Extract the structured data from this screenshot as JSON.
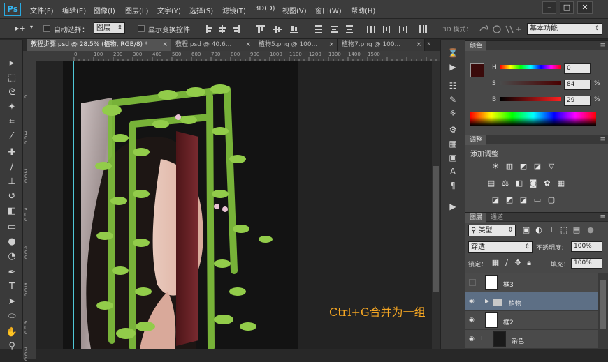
{
  "menubar": {
    "logo": "Ps",
    "items": [
      "文件(F)",
      "编辑(E)",
      "图像(I)",
      "图层(L)",
      "文字(Y)",
      "选择(S)",
      "滤镜(T)",
      "3D(D)",
      "视图(V)",
      "窗口(W)",
      "帮助(H)"
    ],
    "window_controls": {
      "minimize": "–",
      "restore": "□",
      "close": "✕"
    }
  },
  "options": {
    "move_tool_icon": "▸+",
    "auto_select_label": "自动选择：",
    "auto_select_value": "图层",
    "show_transform_label": "显示变换控件",
    "mode_3d_label": "3D 模式：",
    "workspace": "基本功能"
  },
  "tabs": [
    {
      "label": "教程步骤.psd @ 28.5% (植物, RGB/8) *",
      "active": true
    },
    {
      "label": "教程.psd @ 40.6...",
      "active": false
    },
    {
      "label": "植物5.png @ 100...",
      "active": false
    },
    {
      "label": "植物7.png @ 100...",
      "active": false
    }
  ],
  "rulers": {
    "top": [
      "0",
      "100",
      "200",
      "300",
      "400",
      "500",
      "600",
      "700",
      "800",
      "900",
      "1000",
      "1100",
      "1200",
      "1300",
      "1400",
      "1500"
    ],
    "left": [
      "0",
      "100",
      "200",
      "300",
      "400",
      "500",
      "600",
      "700"
    ]
  },
  "color_panel": {
    "tab": "颜色",
    "foreground_color": "#3a0a0a",
    "h_label": "H",
    "h_value": "0",
    "s_label": "S",
    "s_value": "84",
    "s_unit": "%",
    "b_label": "B",
    "b_value": "29",
    "b_unit": "%"
  },
  "adjust_panel": {
    "tab": "调整",
    "title": "添加调整"
  },
  "layers_panel": {
    "tab_layers": "图层",
    "tab_channels": "通道",
    "filter_kind": "类型",
    "blend_mode": "穿透",
    "opacity_label": "不透明度：",
    "opacity_value": "100%",
    "lock_label": "锁定：",
    "fill_label": "填充：",
    "fill_value": "100%",
    "layers": [
      {
        "name": "框3",
        "visible": false,
        "type": "layer"
      },
      {
        "name": "植物",
        "visible": true,
        "type": "group",
        "selected": true
      },
      {
        "name": "框2",
        "visible": true,
        "type": "layer"
      },
      {
        "name": "杂色",
        "visible": true,
        "type": "layer"
      }
    ]
  },
  "annotation": "Ctrl+G合并为一组",
  "colors": {
    "accent_selection": "#5d6f85",
    "guide": "#4fc7d6",
    "annotation": "#f5a623"
  }
}
